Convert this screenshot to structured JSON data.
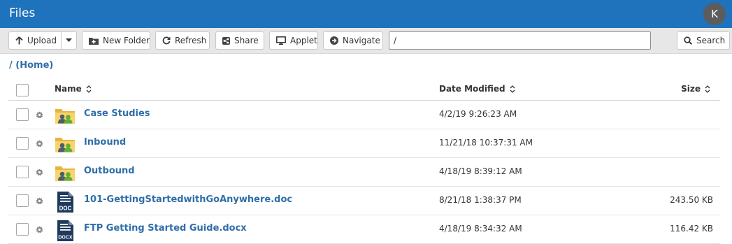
{
  "app": {
    "title": "Files",
    "user_initial": "K",
    "accent_color": "#1f72bc",
    "link_color": "#2f6ea8"
  },
  "toolbar": {
    "upload_label": "Upload",
    "new_folder_label": "New Folder",
    "refresh_label": "Refresh",
    "share_label": "Share",
    "applet_label": "Applet",
    "navigate_label": "Navigate",
    "path_value": "/",
    "search_label": "Search"
  },
  "breadcrumb": "/ (Home)",
  "table": {
    "headers": {
      "name": "Name",
      "date": "Date Modified",
      "size": "Size"
    },
    "rows": [
      {
        "type": "folder-shared",
        "name": "Case Studies",
        "date": "4/2/19 9:26:23 AM",
        "size": ""
      },
      {
        "type": "folder-shared",
        "name": "Inbound",
        "date": "11/21/18 10:37:31 AM",
        "size": ""
      },
      {
        "type": "folder-shared",
        "name": "Outbound",
        "date": "4/18/19 8:39:12 AM",
        "size": ""
      },
      {
        "type": "doc",
        "name": "101-GettingStartedwithGoAnywhere.doc",
        "date": "8/21/18 1:38:37 PM",
        "size": "243.50 KB",
        "icon_label": "DOC"
      },
      {
        "type": "docx",
        "name": "FTP Getting Started Guide.docx",
        "date": "4/18/19 8:34:32 AM",
        "size": "116.42 KB",
        "icon_label": "DOCX"
      }
    ]
  }
}
